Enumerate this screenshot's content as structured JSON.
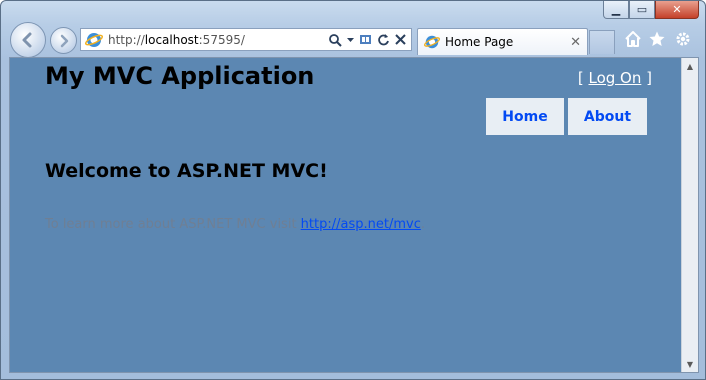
{
  "browser": {
    "url_prefix": "http://",
    "url_host": "localhost",
    "url_rest": ":57595/",
    "tab_title": "Home Page",
    "tab_close": "✕",
    "caption": {
      "minimize": "▁",
      "maximize": "▭",
      "close": "✕"
    },
    "icons": [
      "back-icon",
      "forward-icon",
      "search-icon",
      "compatibility-icon",
      "refresh-icon",
      "stop-icon",
      "home-icon",
      "favorites-star-icon",
      "gear-icon"
    ]
  },
  "page": {
    "site_title": "My MVC Application",
    "logon": {
      "bracket_open": "[",
      "link_label": "Log On",
      "bracket_close": "]"
    },
    "menu": [
      {
        "label": "Home"
      },
      {
        "label": "About"
      }
    ],
    "heading": "Welcome to ASP.NET MVC!",
    "body_text": "To learn more about ASP.NET MVC visit ",
    "body_link": "http://asp.net/mvc",
    "body_text_end": "."
  },
  "colors": {
    "page_background": "#5c87b2",
    "link": "#034af3",
    "menu_tab": "#e8eef4",
    "muted_text": "#6f7f94"
  }
}
